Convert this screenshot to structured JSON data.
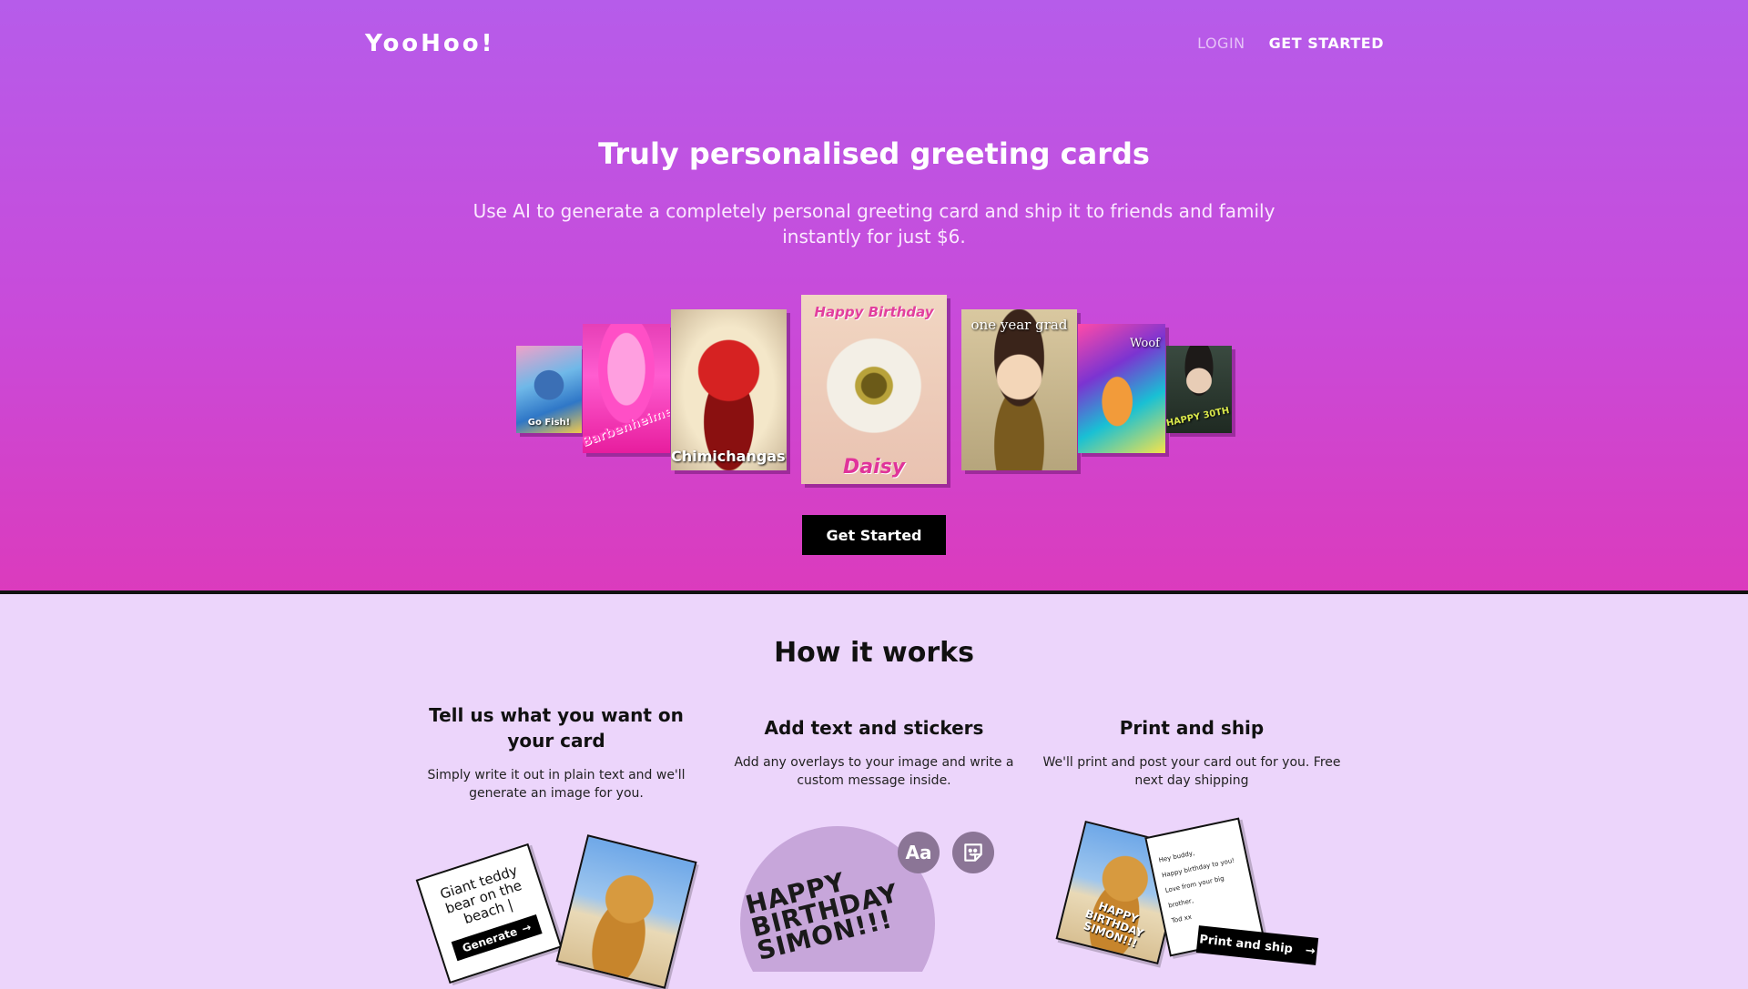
{
  "header": {
    "logo": "YooHoo!",
    "nav": {
      "login": "LOGIN",
      "get_started": "GET STARTED"
    }
  },
  "hero": {
    "title": "Truly personalised greeting cards",
    "subtitle": "Use AI to generate a completely personal greeting card and ship it to friends and family instantly for just $6.",
    "cta": "Get Started",
    "cards": [
      {
        "text": "Go Fish!"
      },
      {
        "text": "Barbenheimer"
      },
      {
        "text": "Chimichangas!"
      },
      {
        "top_text": "Happy Birthday",
        "text": "Daisy"
      },
      {
        "text": "one year grad"
      },
      {
        "text": "Woof"
      },
      {
        "text": "HAPPY 30TH"
      }
    ]
  },
  "how": {
    "title": "How it works",
    "steps": [
      {
        "title": "Tell us what you want on your card",
        "desc": "Simply write it out in plain text and we'll generate an image for you."
      },
      {
        "title": "Add text and stickers",
        "desc": "Add any overlays to your image and write a custom message inside."
      },
      {
        "title": "Print and ship",
        "desc": "We'll print and post your card out for you. Free next day shipping"
      }
    ],
    "illus": {
      "prompt_text": "Giant teddy bear on the beach |",
      "generate": "Generate",
      "overlay_text": "HAPPY BIRTHDAY SIMON!!!",
      "text_tool": "Aa",
      "bear_card_text": "HAPPY BIRTHDAY SIMON!!!",
      "letter_lines": [
        "Hey buddy,",
        "Happy birthday to you!",
        "Love from your big brother,",
        "Tod xx"
      ],
      "print_ship": "Print and ship"
    }
  }
}
